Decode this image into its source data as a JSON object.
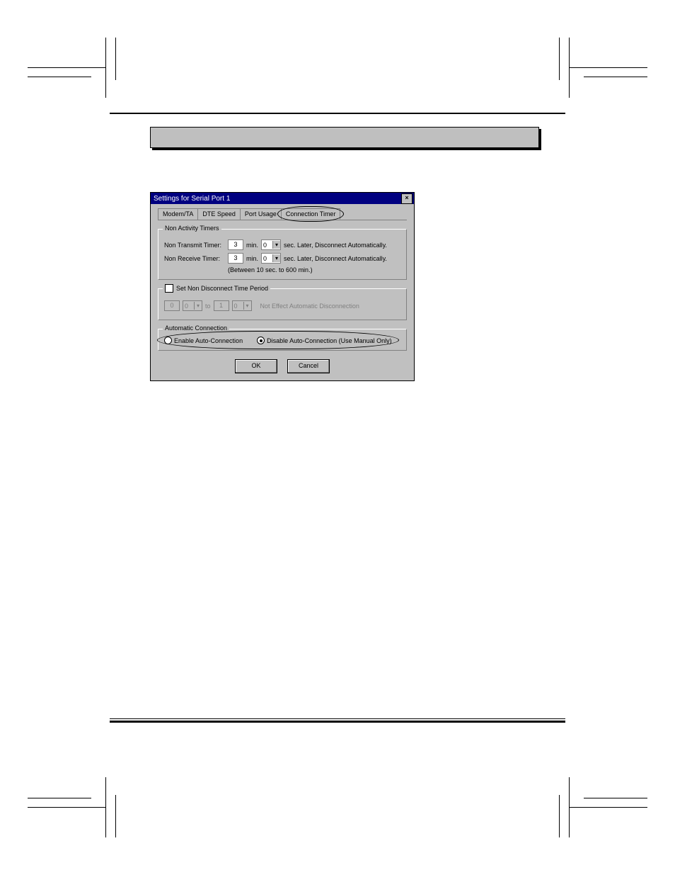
{
  "dialog": {
    "title": "Settings for Serial Port 1",
    "close_glyph": "×",
    "tabs": {
      "modem": "Modem/TA",
      "dte": "DTE Speed",
      "port": "Port Usage",
      "timer": "Connection Timer"
    },
    "non_activity": {
      "legend": "Non Activity Timers",
      "transmit_label": "Non Transmit Timer:",
      "receive_label": "Non Receive Timer:",
      "transmit_min": "3",
      "transmit_sec": "0",
      "receive_min": "3",
      "receive_sec": "0",
      "unit_min": "min.",
      "after_text": "sec. Later, Disconnect Automatically.",
      "range_hint": "(Between 10 sec. to 600 min.)"
    },
    "non_disconnect": {
      "checkbox_label": "Set Non Disconnect Time Period",
      "from_hr": "0",
      "from_min": "0",
      "to_word": "to",
      "to_hr": "1",
      "to_min": "0",
      "note": "Not Effect Automatic Disconnection"
    },
    "auto_connection": {
      "legend": "Automatic Connection",
      "enable_label": "Enable Auto-Connection",
      "disable_label": "Disable Auto-Connection (Use Manual Only)"
    },
    "buttons": {
      "ok": "OK",
      "cancel": "Cancel"
    }
  }
}
